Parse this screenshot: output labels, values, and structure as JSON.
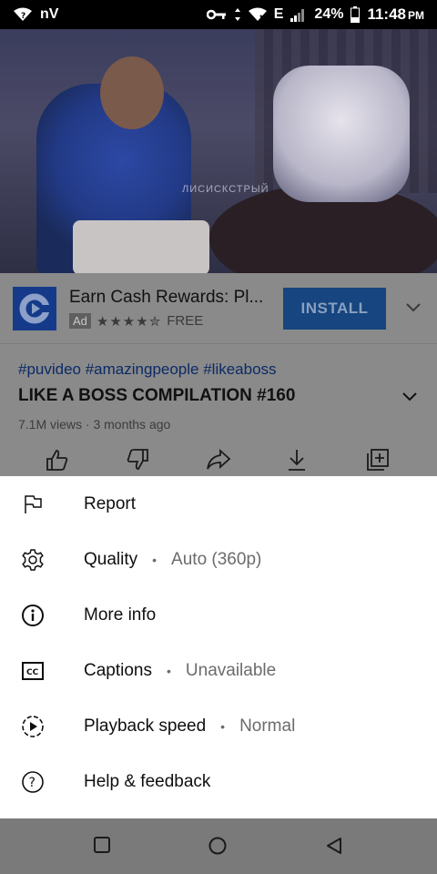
{
  "status_bar": {
    "carrier": "nV",
    "network_type": "E",
    "battery": "24%",
    "time": "11:48",
    "ampm": "PM"
  },
  "video": {
    "watermark": "ЛИСИСКСТРЫЙ"
  },
  "ad": {
    "title": "Earn Cash Rewards: Pl...",
    "badge": "Ad",
    "rating_stars": "★★★★✮",
    "price": "FREE",
    "install_label": "INSTALL"
  },
  "video_info": {
    "hashtags": "#puvideo #amazingpeople #likeaboss",
    "title": "LIKE A BOSS COMPILATION #160",
    "meta": "7.1M views · 3 months ago"
  },
  "menu": {
    "items": [
      {
        "label": "Report",
        "value": "",
        "icon": "flag-icon"
      },
      {
        "label": "Quality",
        "value": "Auto (360p)",
        "icon": "gear-icon"
      },
      {
        "label": "More info",
        "value": "",
        "icon": "info-icon"
      },
      {
        "label": "Captions",
        "value": "Unavailable",
        "icon": "cc-icon"
      },
      {
        "label": "Playback speed",
        "value": "Normal",
        "icon": "playback-speed-icon"
      },
      {
        "label": "Help & feedback",
        "value": "",
        "icon": "help-icon"
      }
    ],
    "separator": "•"
  },
  "colors": {
    "install_button": "#16457f",
    "hashtag": "#0b2a66",
    "sheet_background": "#ffffff",
    "secondary_text": "#6b6b6b"
  }
}
